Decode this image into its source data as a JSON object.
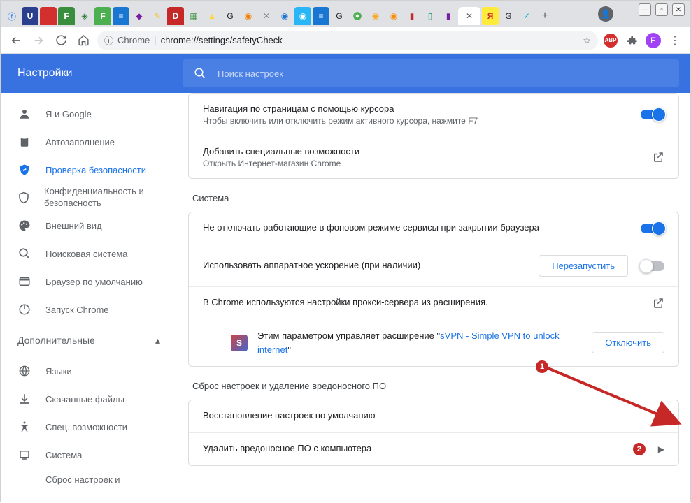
{
  "omnibox": {
    "scheme_label": "Chrome",
    "url": "chrome://settings/safetyCheck"
  },
  "header": {
    "title": "Настройки",
    "search_placeholder": "Поиск настроек"
  },
  "sidebar": {
    "items": [
      {
        "label": "Я и Google"
      },
      {
        "label": "Автозаполнение"
      },
      {
        "label": "Проверка безопасности"
      },
      {
        "label": "Конфиденциальность и безопасность"
      },
      {
        "label": "Внешний вид"
      },
      {
        "label": "Поисковая система"
      },
      {
        "label": "Браузер по умолчанию"
      },
      {
        "label": "Запуск Chrome"
      }
    ],
    "advanced_label": "Дополнительные",
    "adv_items": [
      {
        "label": "Языки"
      },
      {
        "label": "Скачанные файлы"
      },
      {
        "label": "Спец. возможности"
      },
      {
        "label": "Система"
      },
      {
        "label": "Сброс настроек и"
      }
    ]
  },
  "main": {
    "cursor_nav": {
      "title": "Навигация по страницам с помощью курсора",
      "subtitle": "Чтобы включить или отключить режим активного курсора, нажмите F7"
    },
    "a11y_add": {
      "title": "Добавить специальные возможности",
      "subtitle": "Открыть Интернет-магазин Chrome"
    },
    "system_title": "Система",
    "bg_services": {
      "title": "Не отключать работающие в фоновом режиме сервисы при закрытии браузера"
    },
    "hw_accel": {
      "title": "Использовать аппаратное ускорение (при наличии)",
      "restart": "Перезапустить"
    },
    "proxy": {
      "title": "В Chrome используются настройки прокси-сервера из расширения."
    },
    "ext": {
      "prefix": "Этим параметром управляет расширение \"",
      "name": "sVPN - Simple VPN to unlock internet",
      "suffix": "\"",
      "disable": "Отключить"
    },
    "reset_title": "Сброс настроек и удаление вредоносного ПО",
    "restore_defaults": "Восстановление настроек по умолчанию",
    "remove_malware": "Удалить вредоносное ПО с компьютера"
  },
  "annotations": {
    "b1": "1",
    "b2": "2"
  }
}
